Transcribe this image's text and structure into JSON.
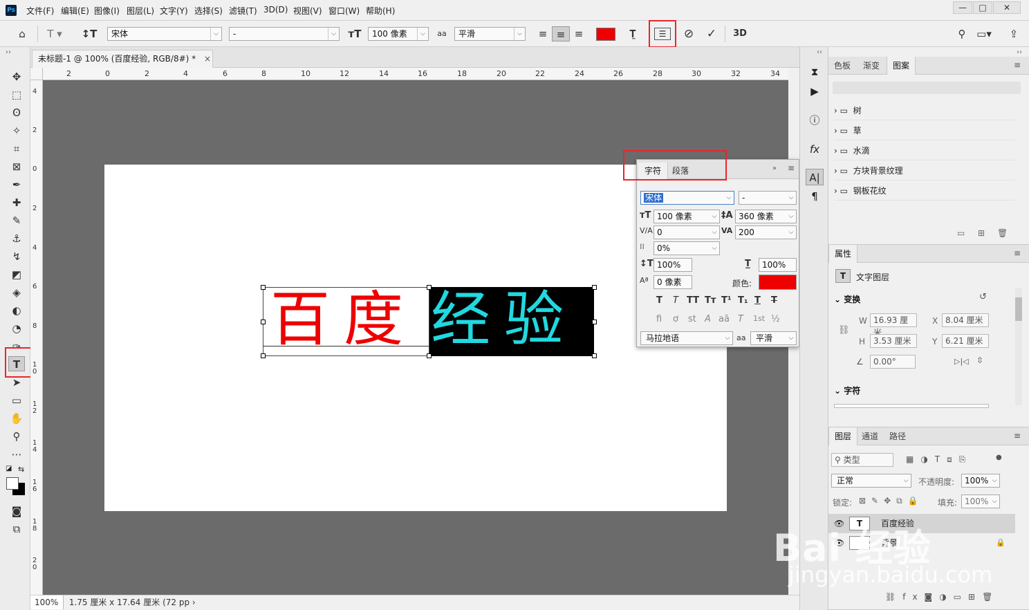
{
  "app": {
    "logo": "Ps",
    "menus": [
      "文件(F)",
      "编辑(E)",
      "图像(I)",
      "图层(L)",
      "文字(Y)",
      "选择(S)",
      "滤镜(T)",
      "3D(D)",
      "视图(V)",
      "窗口(W)",
      "帮助(H)"
    ],
    "window_buttons": [
      "—",
      "□",
      "✕"
    ]
  },
  "options_bar": {
    "font_family": "宋体",
    "font_style": "-",
    "font_size": "100 像素",
    "antialias_glyph": "aa",
    "antialias": "平滑",
    "text_color": "#ee0000",
    "label_3d": "3D"
  },
  "document": {
    "tab_title": "未标题-1 @ 100% (百度经验, RGB/8#) *",
    "close": "×",
    "text_red": "百度",
    "text_cyan": "经验",
    "red_color": "#ee0000",
    "cyan_color": "#22d8e0",
    "highlight_color": "#000000",
    "status_zoom": "100%",
    "status_info": "1.75 厘米 x 17.64 厘米 (72 pp ›"
  },
  "rulers": {
    "h_ticks": [
      "2",
      "0",
      "2",
      "4",
      "6",
      "8",
      "10",
      "12",
      "14",
      "16",
      "18",
      "20",
      "22",
      "24",
      "26",
      "28",
      "30",
      "32",
      "34"
    ],
    "v_ticks": [
      "4",
      "2",
      "0",
      "2",
      "4",
      "6",
      "8",
      "10",
      "12",
      "14",
      "16",
      "18",
      "20"
    ]
  },
  "character_panel": {
    "tabs": [
      "字符",
      "段落"
    ],
    "font_family": "宋体",
    "font_style": "-",
    "font_size": "100 像素",
    "leading": "360 像素",
    "kerning": "0",
    "tracking": "200",
    "scale_percent": "0%",
    "vertical_scale": "100%",
    "horizontal_scale": "100%",
    "baseline_shift": "0 像素",
    "color_label": "颜色:",
    "color": "#ee0000",
    "style_buttons": [
      "T",
      "T",
      "TT",
      "Tт",
      "T¹",
      "T₁",
      "T",
      "T"
    ],
    "ot_buttons": [
      "fi",
      "ơ",
      "st",
      "A",
      "aā",
      "T",
      "1st",
      "½"
    ],
    "language": "马拉地语",
    "antialias_glyph": "aa",
    "antialias": "平滑"
  },
  "patterns_panel": {
    "tabs": [
      "色板",
      "渐变",
      "图案"
    ],
    "groups": [
      "树",
      "草",
      "水滴",
      "方块背景纹理",
      "钢板花纹"
    ]
  },
  "properties_panel": {
    "tab": "属性",
    "layer_type": "文字图层",
    "transform_header": "变换",
    "w_label": "W",
    "w": "16.93 厘米",
    "x_label": "X",
    "x": "8.04 厘米",
    "h_label": "H",
    "h": "3.53 厘米",
    "y_label": "Y",
    "y": "6.21 厘米",
    "angle": "0.00°",
    "character_header": "字符"
  },
  "layers_panel": {
    "tabs": [
      "图层",
      "通道",
      "路径"
    ],
    "filter": "类型",
    "blend_mode": "正常",
    "opacity_label": "不透明度:",
    "opacity": "100%",
    "lock_label": "锁定:",
    "fill_label": "填充:",
    "fill": "100%",
    "layers": [
      {
        "name": "百度经验",
        "type": "text"
      },
      {
        "name": "背景",
        "type": "background"
      }
    ]
  },
  "watermark": {
    "brand": "Bai 经验",
    "url": "jingyan.baidu.com"
  }
}
